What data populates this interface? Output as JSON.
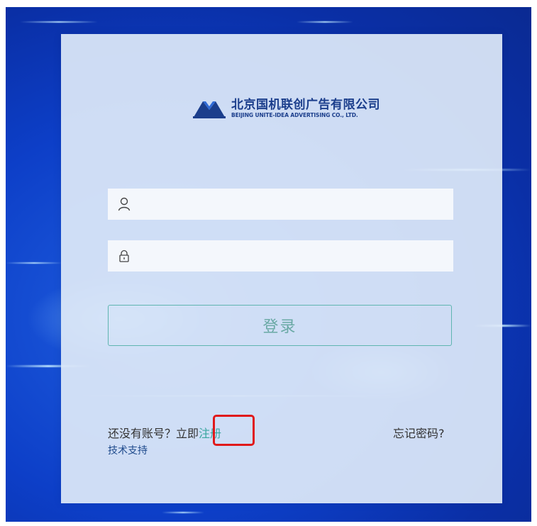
{
  "logo": {
    "company_cn": "北京国机联创广告有限公司",
    "company_en": "BEIJING UNITE-IDEA ADVERTISING CO., LTD."
  },
  "form": {
    "username": {
      "value": "",
      "placeholder": "",
      "icon": "user-icon"
    },
    "password": {
      "value": "",
      "placeholder": "",
      "icon": "lock-icon"
    },
    "login_label": "登录"
  },
  "footer": {
    "no_account_text": "还没有账号？立即",
    "register_label": "注册",
    "forgot_password": "忘记密码?",
    "tech_support": "技术支持"
  },
  "colors": {
    "background_blue": "#0d3fc8",
    "card_bg": "#e0eaf8",
    "brand_navy": "#1b3e8c",
    "accent_teal": "#5fb5b0",
    "highlight_red": "#e0191a"
  }
}
